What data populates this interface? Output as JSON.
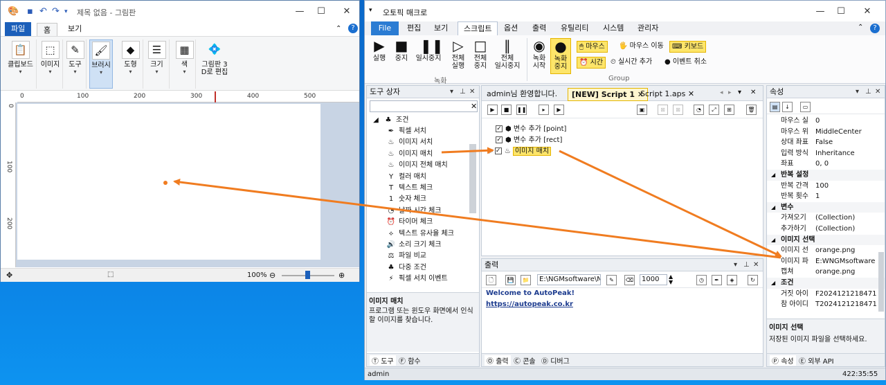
{
  "paint": {
    "title": "제목 없음 - 그림판",
    "tabs": [
      "파일",
      "홈",
      "보기"
    ],
    "tools": [
      "클립보드",
      "이미지",
      "도구",
      "브러시",
      "도형",
      "크기",
      "색",
      "그림판 3\nD로 편집"
    ],
    "ruler_h": [
      "0",
      "100",
      "200",
      "300",
      "400",
      "500"
    ],
    "ruler_v": [
      "0",
      "100",
      "200"
    ],
    "zoom": "100%"
  },
  "ap": {
    "title": "오토픽 매크로",
    "tabs": [
      "File",
      "편집",
      "보기",
      "스크립트",
      "옵션",
      "출력",
      "유틸리티",
      "시스템",
      "관리자"
    ],
    "ribbon": {
      "record_group": "녹화",
      "group": "Group",
      "run": "실행",
      "stop": "중지",
      "pause": "일시중지",
      "run_all": "전체\n실행",
      "stop_all": "전체\n중지",
      "pause_all": "전체\n일시중지",
      "rec_start": "녹화\n시작",
      "rec_stop": "녹화\n중지",
      "mouse": "마우스",
      "mouse_move": "마우스 이동",
      "keyboard": "키보드",
      "time": "시간",
      "add_pause": "실시간 추가",
      "cancel_event": "이벤트 취소"
    },
    "toolbox": {
      "header": "도구 상자",
      "root": "조건",
      "items": [
        "픽셀 서치",
        "이미지 서치",
        "이미지 매치",
        "이미지 전체 매치",
        "컬러 매치",
        "텍스트 체크",
        "숫자 체크",
        "날짜 시간 체크",
        "타이머 체크",
        "텍스트 유사율 체크",
        "소리 크기 체크",
        "파일 비교",
        "다중 조건",
        "픽셀 서치 이벤트"
      ],
      "desc_title": "이미지 매치",
      "desc": "프로그램 또는 윈도우 화면에서 인식할 이미지를 찾습니다.",
      "tab1": "도구",
      "tab2": "함수"
    },
    "editor": {
      "tabs": [
        "admin님 환영합니다.",
        "[NEW] Script 1",
        "Script 1.aps"
      ],
      "lines": [
        "변수 추가 [point]",
        "변수 추가 [rect]",
        "이미지 매치"
      ]
    },
    "output": {
      "header": "출력",
      "path": "E:\\NGMsoftware\\NG",
      "num": "1000",
      "welcome": "Welcome to AutoPeak!",
      "link": "https://autopeak.co.kr",
      "tab1": "출력",
      "tab2": "콘솔",
      "tab3": "디버그"
    },
    "props": {
      "header": "속성",
      "rows": [
        {
          "k": "마우스 실",
          "v": "0",
          "cat": false
        },
        {
          "k": "마우스 위",
          "v": "MiddleCenter",
          "cat": false
        },
        {
          "k": "상대 좌표",
          "v": "False",
          "cat": false
        },
        {
          "k": "입력 방식",
          "v": "Inheritance",
          "cat": false
        },
        {
          "k": "좌표",
          "v": "0, 0",
          "cat": false
        },
        {
          "k": "반복 설정",
          "v": "",
          "cat": true
        },
        {
          "k": "반복 간격",
          "v": "100",
          "cat": false
        },
        {
          "k": "반복 횟수",
          "v": "1",
          "cat": false
        },
        {
          "k": "변수",
          "v": "",
          "cat": true
        },
        {
          "k": "가져오기",
          "v": "(Collection)",
          "cat": false
        },
        {
          "k": "추가하기",
          "v": "(Collection)",
          "cat": false
        },
        {
          "k": "이미지 선택",
          "v": "",
          "cat": true
        },
        {
          "k": "이미지 선",
          "v": "orange.png",
          "cat": false
        },
        {
          "k": "이미지 파",
          "v": "E:WNGMsoftware",
          "cat": false
        },
        {
          "k": "캡쳐",
          "v": "orange.png",
          "cat": false
        },
        {
          "k": "조건",
          "v": "",
          "cat": true
        },
        {
          "k": "거짓 아이",
          "v": "F2024121218471",
          "cat": false
        },
        {
          "k": "참 아이디",
          "v": "T2024121218471",
          "cat": false
        }
      ],
      "desc_title": "이미지 선택",
      "desc": "저장된 이미지 파일을 선택하세요.",
      "tab1": "속성",
      "tab2": "외부 API"
    },
    "status_user": "admin",
    "status_time": "422:35:55",
    "colors": {
      "arrow": "#f07c20",
      "highlight": "#fde56a",
      "accent": "#2b7cd3"
    }
  }
}
